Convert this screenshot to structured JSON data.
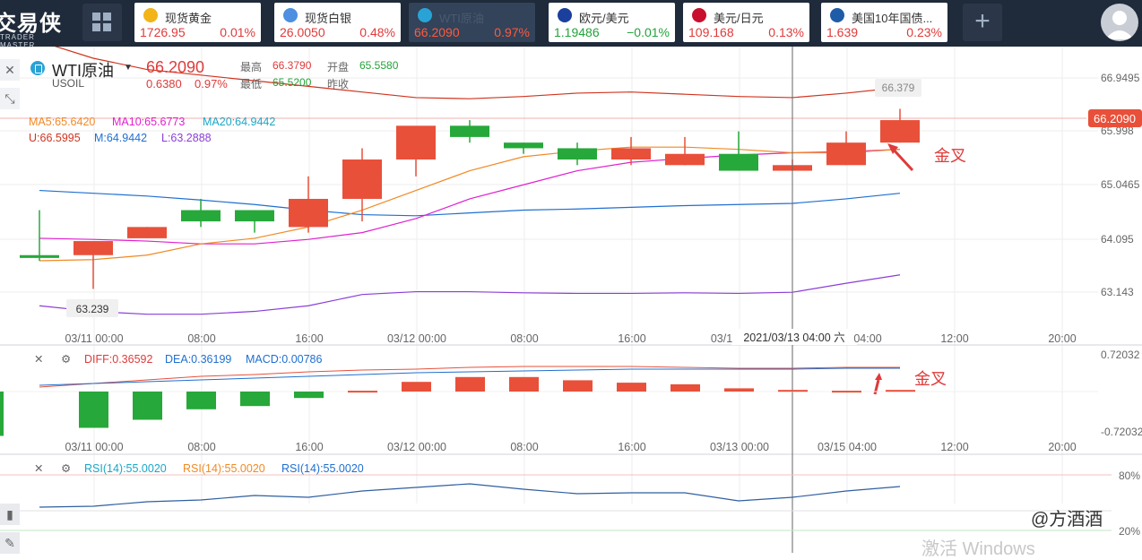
{
  "logo": {
    "big": "交易侠",
    "small": "TRADER MASTER"
  },
  "tickers": [
    {
      "name": "现货黄金",
      "price": "1726.95",
      "change": "0.01%",
      "icon_color": "#f2b418",
      "price_color": "#e03a3a",
      "change_color": "#e03a3a",
      "active": false
    },
    {
      "name": "现货白银",
      "price": "26.0050",
      "change": "0.48%",
      "icon_color": "#4d8fe0",
      "price_color": "#e03a3a",
      "change_color": "#e03a3a",
      "active": false
    },
    {
      "name": "WTI原油",
      "price": "66.2090",
      "change": "0.97%",
      "icon_color": "#29a3d6",
      "price_color": "#ff5a3c",
      "change_color": "#ff5a3c",
      "active": true
    },
    {
      "name": "欧元/美元",
      "price": "1.19486",
      "change": "−0.01%",
      "icon_color": "#1b3f9c",
      "price_color": "#22a33a",
      "change_color": "#22a33a",
      "active": false
    },
    {
      "name": "美元/日元",
      "price": "109.168",
      "change": "0.13%",
      "icon_color": "#c8102e",
      "price_color": "#e03a3a",
      "change_color": "#e03a3a",
      "active": false
    },
    {
      "name": "美国10年国债...",
      "price": "1.639",
      "change": "0.23%",
      "icon_color": "#1f5ca8",
      "price_color": "#e03a3a",
      "change_color": "#e03a3a",
      "active": false
    }
  ],
  "symbol": {
    "name": "WTI原油",
    "code": "USOIL",
    "price": "66.2090",
    "change": "0.6380",
    "change_pct": "0.97%",
    "high_label": "最高",
    "high": "66.3790",
    "open_label": "开盘",
    "open": "65.5580",
    "low_label": "最低",
    "low": "65.5200",
    "prev_label": "昨收",
    "prev": ""
  },
  "indicators": {
    "ma5": "MA5:65.6420",
    "ma10": "MA10:65.6773",
    "ma20": "MA20:64.9442",
    "boll_u": "U:66.5995",
    "boll_m": "M:64.9442",
    "boll_l": "L:63.2888",
    "diff": "DIFF:0.36592",
    "dea": "DEA:0.36199",
    "macd": "MACD:0.00786",
    "rsi1": "RSI(14):55.0020",
    "rsi2": "RSI(14):55.0020",
    "rsi3": "RSI(14):55.0020"
  },
  "annotations": {
    "golden_cross_1": "金叉",
    "golden_cross_2": "金叉"
  },
  "watermark": {
    "activate": "激活 Windows",
    "author": "@方酒酒"
  },
  "chart_data": {
    "type": "candlestick",
    "price_axis_labels": [
      "66.9495",
      "65.998",
      "65.0465",
      "64.095",
      "63.143"
    ],
    "current_price_tag": "66.2090",
    "high_tag": "66.379",
    "low_tag": "63.239",
    "crosshair_time": "2021/03/13 04:00 六",
    "time_labels_main": [
      "03/11 00:00",
      "08:00",
      "16:00",
      "03/12 00:00",
      "08:00",
      "16:00",
      "03/1",
      "04:00",
      "12:00",
      "20:00"
    ],
    "time_labels_macd": [
      "03/11 00:00",
      "08:00",
      "16:00",
      "03/12 00:00",
      "08:00",
      "16:00",
      "03/13 00:00",
      "03/15 04:00",
      "12:00",
      "20:00"
    ],
    "macd_axis_labels": [
      "0.72032",
      "-0.72032"
    ],
    "rsi_axis_labels": [
      "80%",
      "20%"
    ],
    "candles": [
      {
        "o": 63.8,
        "h": 64.6,
        "l": 63.7,
        "c": 63.75
      },
      {
        "o": 63.8,
        "h": 64.0,
        "l": 63.2,
        "c": 64.05
      },
      {
        "o": 64.1,
        "h": 64.3,
        "l": 64.1,
        "c": 64.3
      },
      {
        "o": 64.6,
        "h": 64.8,
        "l": 64.3,
        "c": 64.4
      },
      {
        "o": 64.6,
        "h": 64.6,
        "l": 64.2,
        "c": 64.4
      },
      {
        "o": 64.3,
        "h": 65.2,
        "l": 64.2,
        "c": 64.8
      },
      {
        "o": 64.8,
        "h": 65.7,
        "l": 64.4,
        "c": 65.5
      },
      {
        "o": 65.5,
        "h": 65.5,
        "l": 65.2,
        "c": 66.1
      },
      {
        "o": 66.1,
        "h": 66.2,
        "l": 65.8,
        "c": 65.9
      },
      {
        "o": 65.8,
        "h": 65.8,
        "l": 65.6,
        "c": 65.7
      },
      {
        "o": 65.7,
        "h": 65.8,
        "l": 65.4,
        "c": 65.5
      },
      {
        "o": 65.5,
        "h": 65.9,
        "l": 65.4,
        "c": 65.7
      },
      {
        "o": 65.4,
        "h": 65.9,
        "l": 65.4,
        "c": 65.6
      },
      {
        "o": 65.6,
        "h": 66.0,
        "l": 65.3,
        "c": 65.3
      },
      {
        "o": 65.3,
        "h": 65.5,
        "l": 65.3,
        "c": 65.4
      },
      {
        "o": 65.4,
        "h": 66.0,
        "l": 65.4,
        "c": 65.8
      },
      {
        "o": 65.8,
        "h": 66.4,
        "l": 65.8,
        "c": 66.2
      }
    ],
    "macd_hist": [
      -0.55,
      -0.45,
      -0.35,
      -0.22,
      -0.18,
      -0.08,
      0.01,
      0.12,
      0.18,
      0.18,
      0.14,
      0.11,
      0.09,
      0.04,
      0.02,
      0.01,
      0.02
    ]
  }
}
